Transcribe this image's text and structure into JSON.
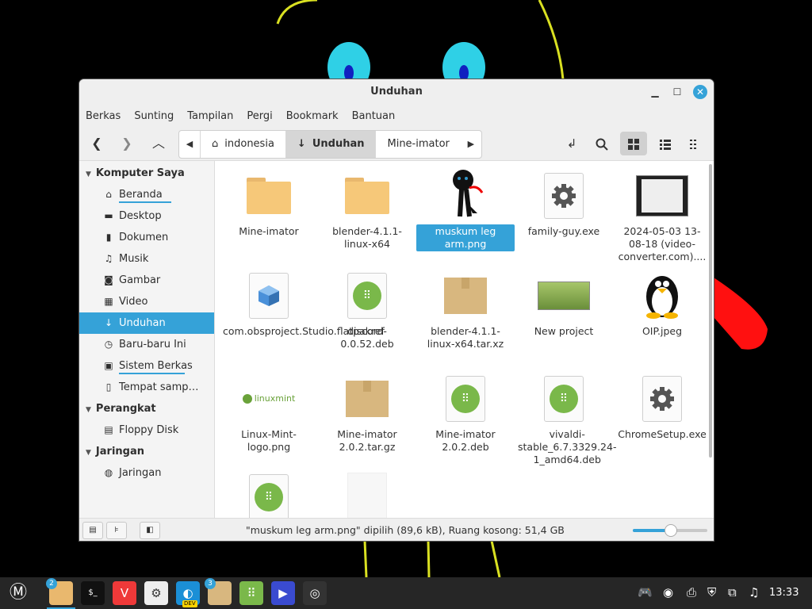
{
  "window": {
    "title": "Unduhan"
  },
  "menubar": [
    "Berkas",
    "Sunting",
    "Tampilan",
    "Pergi",
    "Bookmark",
    "Bantuan"
  ],
  "pathbar": {
    "crumbs": [
      "indonesia",
      "Unduhan",
      "Mine-imator"
    ],
    "active_index": 1
  },
  "sidebar": {
    "sections": [
      {
        "title": "Komputer Saya",
        "items": [
          {
            "label": "Beranda",
            "icon": "home-icon",
            "usage": 0.6
          },
          {
            "label": "Desktop",
            "icon": "desktop-icon"
          },
          {
            "label": "Dokumen",
            "icon": "document-icon"
          },
          {
            "label": "Musik",
            "icon": "music-icon"
          },
          {
            "label": "Gambar",
            "icon": "camera-icon"
          },
          {
            "label": "Video",
            "icon": "video-icon"
          },
          {
            "label": "Unduhan",
            "icon": "download-icon",
            "selected": true
          },
          {
            "label": "Baru-baru Ini",
            "icon": "clock-icon"
          },
          {
            "label": "Sistem Berkas",
            "icon": "drive-icon",
            "usage": 0.75
          },
          {
            "label": "Tempat samp…",
            "icon": "trash-icon"
          }
        ]
      },
      {
        "title": "Perangkat",
        "items": [
          {
            "label": "Floppy Disk",
            "icon": "floppy-icon"
          }
        ]
      },
      {
        "title": "Jaringan",
        "items": [
          {
            "label": "Jaringan",
            "icon": "network-icon"
          }
        ]
      }
    ]
  },
  "files": [
    {
      "name": "Mine-imator",
      "kind": "folder"
    },
    {
      "name": "blender-4.1.1-linux-x64",
      "kind": "folder"
    },
    {
      "name": "muskum leg arm.png",
      "kind": "image-stickman",
      "selected": true
    },
    {
      "name": "family-guy.exe",
      "kind": "exe"
    },
    {
      "name": "2024-05-03 13-08-18 (video-converter.com)....",
      "kind": "video"
    },
    {
      "name": "com.obsproject.Studio.flatpakref",
      "kind": "flatpakref"
    },
    {
      "name": "discord-0.0.52.deb",
      "kind": "deb"
    },
    {
      "name": "blender-4.1.1-linux-x64.tar.xz",
      "kind": "archive"
    },
    {
      "name": "New project",
      "kind": "image-mint"
    },
    {
      "name": "OIP.jpeg",
      "kind": "image-tux"
    },
    {
      "name": "Linux-Mint-logo.png",
      "kind": "image-mintlogo",
      "logo_text": "linuxmint"
    },
    {
      "name": "Mine-imator 2.0.2.tar.gz",
      "kind": "archive"
    },
    {
      "name": "Mine-imator 2.0.2.deb",
      "kind": "deb"
    },
    {
      "name": "vivaldi-stable_6.7.3329.24-1_amd64.deb",
      "kind": "deb"
    },
    {
      "name": "ChromeSetup.exe",
      "kind": "exe"
    },
    {
      "name": "",
      "kind": "deb"
    },
    {
      "name": "",
      "kind": "blank"
    }
  ],
  "statusbar": {
    "text": "\"muskum leg arm.png\" dipilih (89,6 kB), Ruang kosong: 51,4 GB",
    "zoom": 0.5
  },
  "taskbar": {
    "apps": [
      {
        "name": "mint-menu-icon"
      },
      {
        "name": "files-icon",
        "badge": "2",
        "active": true
      },
      {
        "name": "terminal-icon"
      },
      {
        "name": "vivaldi-icon"
      },
      {
        "name": "settings-icon"
      },
      {
        "name": "edge-dev-icon",
        "badge_text": "DEV"
      },
      {
        "name": "archive-icon",
        "badge": "3"
      },
      {
        "name": "software-manager-icon"
      },
      {
        "name": "media-player-icon"
      },
      {
        "name": "obs-icon"
      }
    ],
    "clock": "13:33"
  },
  "colors": {
    "accent": "#35a2d8",
    "taskbar": "#262626"
  }
}
